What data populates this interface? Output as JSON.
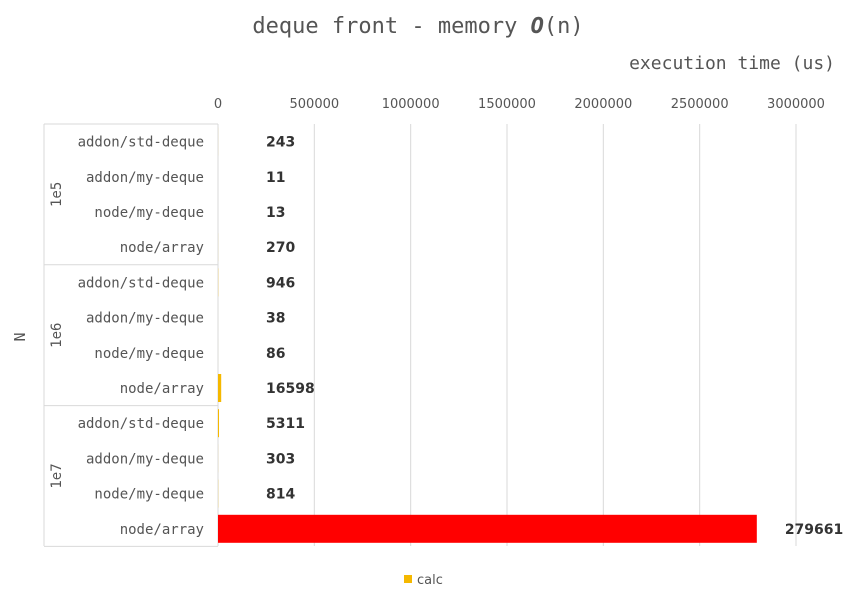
{
  "chart_data": {
    "type": "bar",
    "orientation": "horizontal",
    "title_prefix": "deque front - memory ",
    "title_o": "O",
    "title_suffix": "(n)",
    "xlabel": "execution time (us)",
    "ylabel": "N",
    "xlim": [
      0,
      3000000
    ],
    "xticks": [
      0,
      500000,
      1000000,
      1500000,
      2000000,
      2500000,
      3000000
    ],
    "xtick_labels": [
      "0",
      "500000",
      "1000000",
      "1500000",
      "2000000",
      "2500000",
      "3000000"
    ],
    "x_axis_position": "top",
    "grid": true,
    "legend_position": "bottom-center",
    "groups": [
      {
        "name": "1e5",
        "categories": [
          "addon/std-deque",
          "addon/my-deque",
          "node/my-deque",
          "node/array"
        ],
        "values": [
          243,
          11,
          13,
          270
        ],
        "labels": [
          "243",
          "11",
          "13",
          "270"
        ]
      },
      {
        "name": "1e6",
        "categories": [
          "addon/std-deque",
          "addon/my-deque",
          "node/my-deque",
          "node/array"
        ],
        "values": [
          946,
          38,
          86,
          16598
        ],
        "labels": [
          "946",
          "38",
          "86",
          "16598"
        ]
      },
      {
        "name": "1e7",
        "categories": [
          "addon/std-deque",
          "addon/my-deque",
          "node/my-deque",
          "node/array"
        ],
        "values": [
          5311,
          303,
          814,
          2796610
        ],
        "labels": [
          "5311",
          "303",
          "814",
          "279661"
        ]
      }
    ],
    "series": [
      {
        "name": "calc",
        "color": "#F5B800"
      }
    ],
    "highlight_color": "#FF0000",
    "highlight": {
      "group": 2,
      "index": 3
    }
  }
}
